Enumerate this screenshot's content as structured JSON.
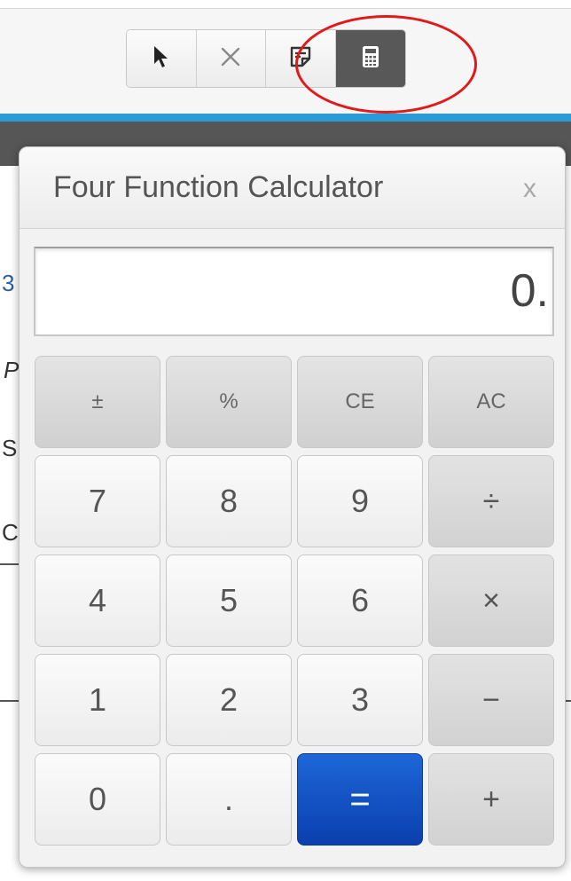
{
  "toolbar": {
    "tools": [
      {
        "icon": "pointer-arrow-icon",
        "active": false
      },
      {
        "icon": "cross-out-icon",
        "active": false
      },
      {
        "icon": "notepad-icon",
        "active": false
      },
      {
        "icon": "calculator-icon",
        "active": true
      }
    ]
  },
  "background_fragments": {
    "f1": "3",
    "f2": "P",
    "f3": "S",
    "f4": "C"
  },
  "calculator": {
    "title": "Four Function Calculator",
    "close_label": "x",
    "display_value": "0.",
    "keys": {
      "plusminus": "±",
      "percent": "%",
      "ce": "CE",
      "ac": "AC",
      "seven": "7",
      "eight": "8",
      "nine": "9",
      "divide": "÷",
      "four": "4",
      "five": "5",
      "six": "6",
      "multiply": "×",
      "one": "1",
      "two": "2",
      "three": "3",
      "minus": "−",
      "zero": "0",
      "decimal": ".",
      "equals": "=",
      "plus": "+"
    }
  },
  "colors": {
    "accent_blue_bar": "#2a9ad9",
    "equals_button": "#0a3fae",
    "annotation_circle": "#e01a1a",
    "active_tool": "#585858"
  }
}
